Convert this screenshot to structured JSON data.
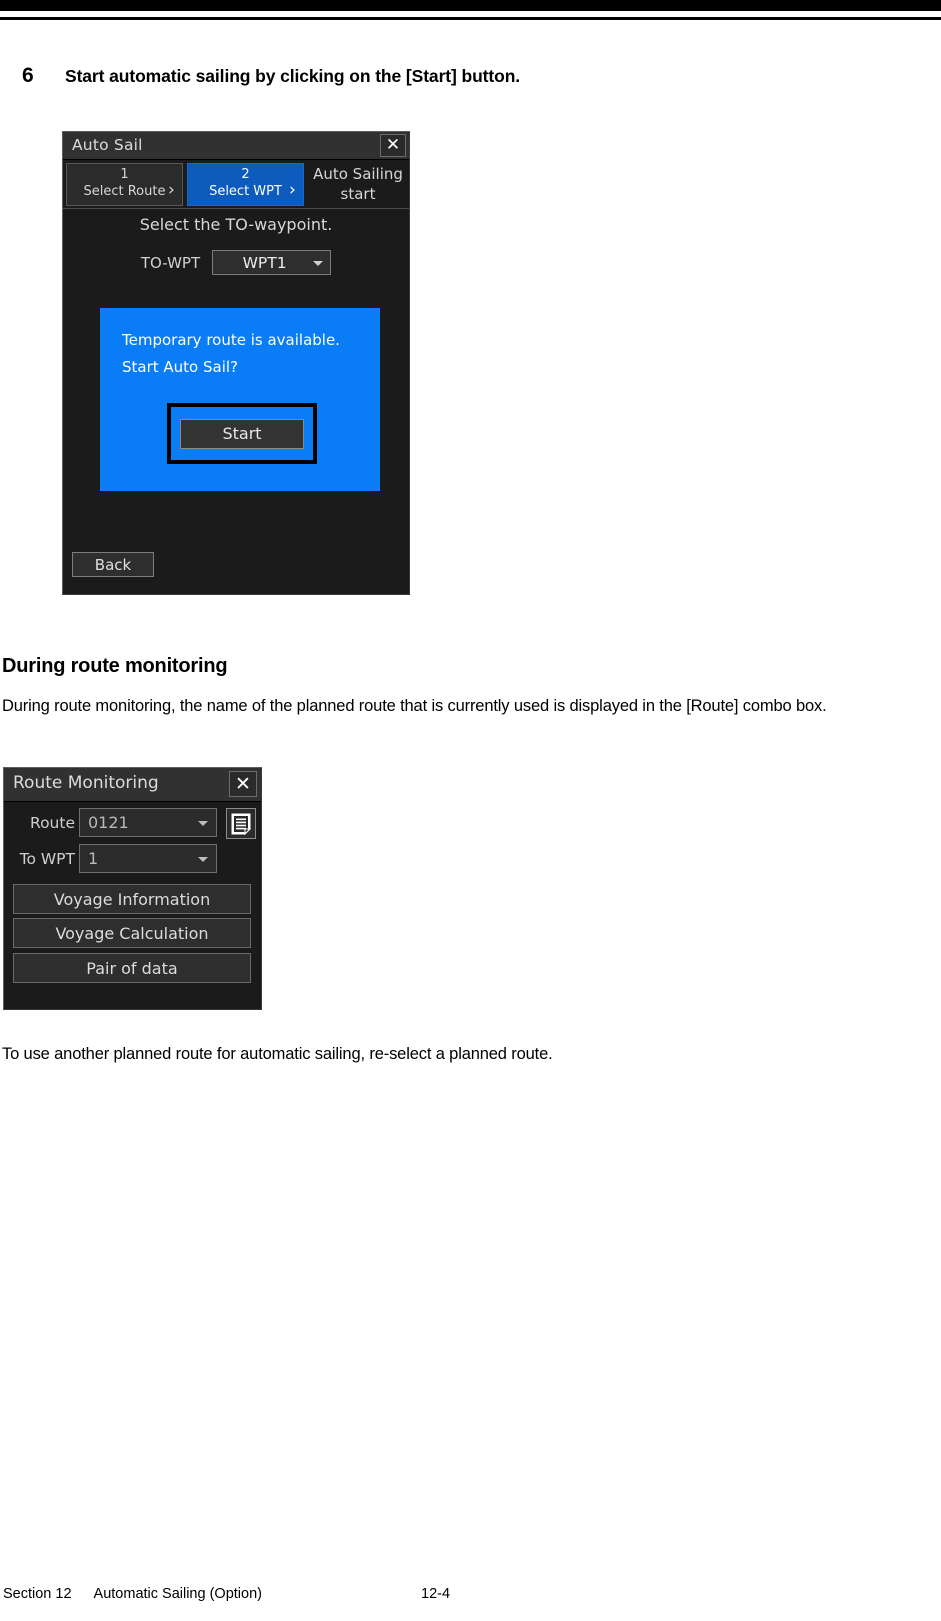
{
  "document": {
    "step": {
      "number": "6",
      "text": "Start automatic sailing by clicking on the [Start] button."
    },
    "section_heading": "During route monitoring",
    "paragraph_1": "During route monitoring, the name of the planned route that is currently used is displayed in the [Route] combo box.",
    "paragraph_2": "To use another planned route for automatic sailing, re-select a planned route.",
    "footer": {
      "section": "Section 12",
      "title": "Automatic Sailing (Option)",
      "page": "12-4"
    }
  },
  "auto_sail_dialog": {
    "title": "Auto Sail",
    "close_icon": "✕",
    "steps": [
      {
        "number": "1",
        "label": "Select Route",
        "chevron": "›"
      },
      {
        "number": "2",
        "label": "Select WPT",
        "chevron": "›"
      },
      {
        "number": "Auto Sailing",
        "label": "start"
      }
    ],
    "instruction": "Select the TO-waypoint.",
    "to_wpt_label": "TO-WPT",
    "to_wpt_value": "WPT1",
    "confirm_panel": {
      "line_1": "Temporary route is available.",
      "line_2": "Start Auto Sail?",
      "start_label": "Start",
      "background_color": "#0a7cf5"
    },
    "back_label": "Back",
    "active_step_color": "#0d5cbd"
  },
  "route_monitoring_dialog": {
    "title": "Route Monitoring",
    "close_icon": "✕",
    "route_label": "Route",
    "route_value": "0121",
    "to_wpt_label": "To WPT",
    "to_wpt_value": "1",
    "list_icon": "list-document-icon",
    "buttons": [
      "Voyage Information",
      "Voyage Calculation",
      "Pair of data"
    ]
  }
}
